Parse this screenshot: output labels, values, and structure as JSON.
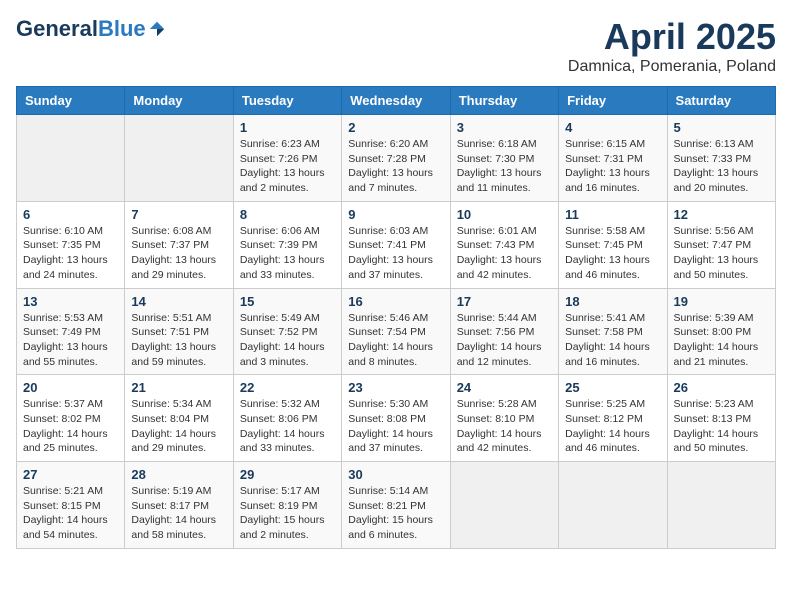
{
  "header": {
    "logo_general": "General",
    "logo_blue": "Blue",
    "month_title": "April 2025",
    "location": "Damnica, Pomerania, Poland"
  },
  "weekdays": [
    "Sunday",
    "Monday",
    "Tuesday",
    "Wednesday",
    "Thursday",
    "Friday",
    "Saturday"
  ],
  "weeks": [
    [
      {
        "day": "",
        "info": ""
      },
      {
        "day": "",
        "info": ""
      },
      {
        "day": "1",
        "info": "Sunrise: 6:23 AM\nSunset: 7:26 PM\nDaylight: 13 hours and 2 minutes."
      },
      {
        "day": "2",
        "info": "Sunrise: 6:20 AM\nSunset: 7:28 PM\nDaylight: 13 hours and 7 minutes."
      },
      {
        "day": "3",
        "info": "Sunrise: 6:18 AM\nSunset: 7:30 PM\nDaylight: 13 hours and 11 minutes."
      },
      {
        "day": "4",
        "info": "Sunrise: 6:15 AM\nSunset: 7:31 PM\nDaylight: 13 hours and 16 minutes."
      },
      {
        "day": "5",
        "info": "Sunrise: 6:13 AM\nSunset: 7:33 PM\nDaylight: 13 hours and 20 minutes."
      }
    ],
    [
      {
        "day": "6",
        "info": "Sunrise: 6:10 AM\nSunset: 7:35 PM\nDaylight: 13 hours and 24 minutes."
      },
      {
        "day": "7",
        "info": "Sunrise: 6:08 AM\nSunset: 7:37 PM\nDaylight: 13 hours and 29 minutes."
      },
      {
        "day": "8",
        "info": "Sunrise: 6:06 AM\nSunset: 7:39 PM\nDaylight: 13 hours and 33 minutes."
      },
      {
        "day": "9",
        "info": "Sunrise: 6:03 AM\nSunset: 7:41 PM\nDaylight: 13 hours and 37 minutes."
      },
      {
        "day": "10",
        "info": "Sunrise: 6:01 AM\nSunset: 7:43 PM\nDaylight: 13 hours and 42 minutes."
      },
      {
        "day": "11",
        "info": "Sunrise: 5:58 AM\nSunset: 7:45 PM\nDaylight: 13 hours and 46 minutes."
      },
      {
        "day": "12",
        "info": "Sunrise: 5:56 AM\nSunset: 7:47 PM\nDaylight: 13 hours and 50 minutes."
      }
    ],
    [
      {
        "day": "13",
        "info": "Sunrise: 5:53 AM\nSunset: 7:49 PM\nDaylight: 13 hours and 55 minutes."
      },
      {
        "day": "14",
        "info": "Sunrise: 5:51 AM\nSunset: 7:51 PM\nDaylight: 13 hours and 59 minutes."
      },
      {
        "day": "15",
        "info": "Sunrise: 5:49 AM\nSunset: 7:52 PM\nDaylight: 14 hours and 3 minutes."
      },
      {
        "day": "16",
        "info": "Sunrise: 5:46 AM\nSunset: 7:54 PM\nDaylight: 14 hours and 8 minutes."
      },
      {
        "day": "17",
        "info": "Sunrise: 5:44 AM\nSunset: 7:56 PM\nDaylight: 14 hours and 12 minutes."
      },
      {
        "day": "18",
        "info": "Sunrise: 5:41 AM\nSunset: 7:58 PM\nDaylight: 14 hours and 16 minutes."
      },
      {
        "day": "19",
        "info": "Sunrise: 5:39 AM\nSunset: 8:00 PM\nDaylight: 14 hours and 21 minutes."
      }
    ],
    [
      {
        "day": "20",
        "info": "Sunrise: 5:37 AM\nSunset: 8:02 PM\nDaylight: 14 hours and 25 minutes."
      },
      {
        "day": "21",
        "info": "Sunrise: 5:34 AM\nSunset: 8:04 PM\nDaylight: 14 hours and 29 minutes."
      },
      {
        "day": "22",
        "info": "Sunrise: 5:32 AM\nSunset: 8:06 PM\nDaylight: 14 hours and 33 minutes."
      },
      {
        "day": "23",
        "info": "Sunrise: 5:30 AM\nSunset: 8:08 PM\nDaylight: 14 hours and 37 minutes."
      },
      {
        "day": "24",
        "info": "Sunrise: 5:28 AM\nSunset: 8:10 PM\nDaylight: 14 hours and 42 minutes."
      },
      {
        "day": "25",
        "info": "Sunrise: 5:25 AM\nSunset: 8:12 PM\nDaylight: 14 hours and 46 minutes."
      },
      {
        "day": "26",
        "info": "Sunrise: 5:23 AM\nSunset: 8:13 PM\nDaylight: 14 hours and 50 minutes."
      }
    ],
    [
      {
        "day": "27",
        "info": "Sunrise: 5:21 AM\nSunset: 8:15 PM\nDaylight: 14 hours and 54 minutes."
      },
      {
        "day": "28",
        "info": "Sunrise: 5:19 AM\nSunset: 8:17 PM\nDaylight: 14 hours and 58 minutes."
      },
      {
        "day": "29",
        "info": "Sunrise: 5:17 AM\nSunset: 8:19 PM\nDaylight: 15 hours and 2 minutes."
      },
      {
        "day": "30",
        "info": "Sunrise: 5:14 AM\nSunset: 8:21 PM\nDaylight: 15 hours and 6 minutes."
      },
      {
        "day": "",
        "info": ""
      },
      {
        "day": "",
        "info": ""
      },
      {
        "day": "",
        "info": ""
      }
    ]
  ]
}
